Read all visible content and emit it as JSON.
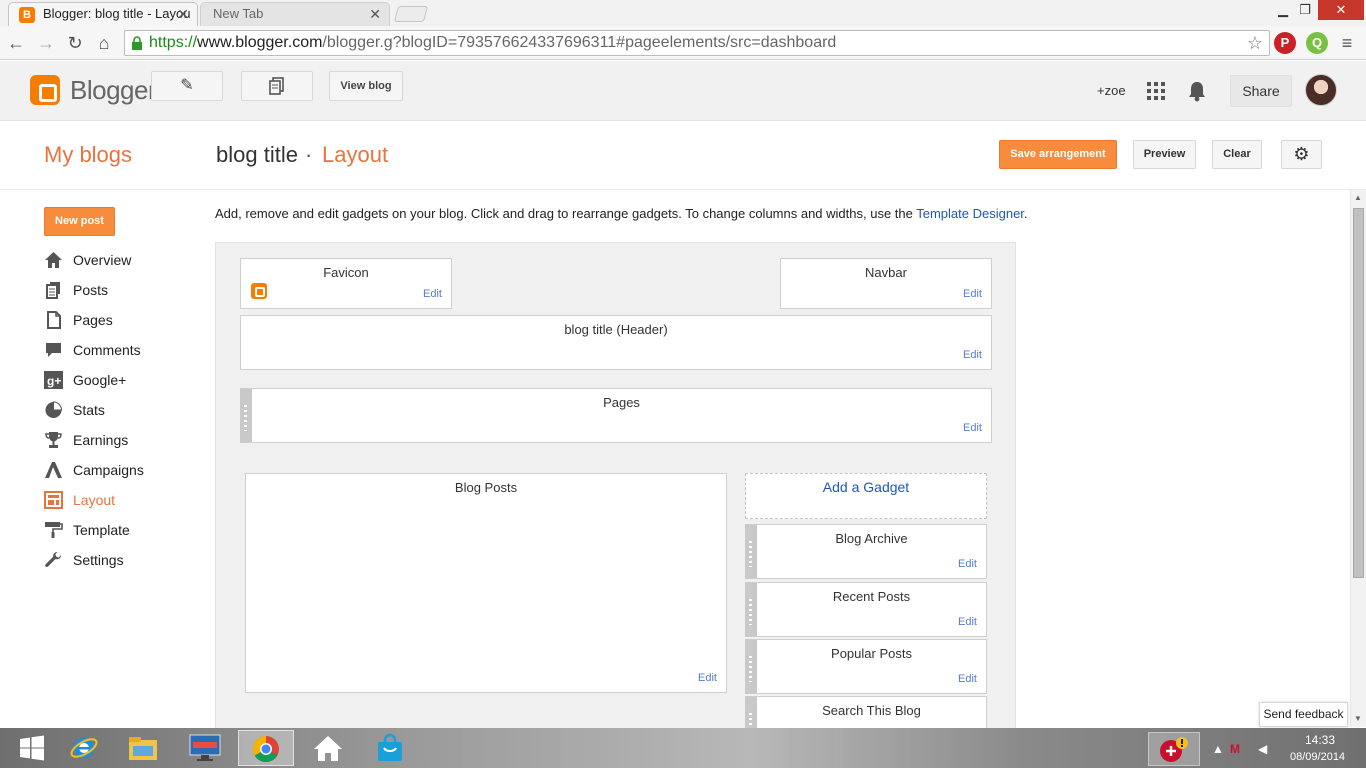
{
  "browser": {
    "active_tab_title": "Blogger: blog title - Layou",
    "inactive_tab_title": "New Tab",
    "url_scheme": "https://",
    "url_rest": "www.blogger.com/blogger.g?blogID=7935766243376963 11#pageelements/src=dashboard",
    "url_display_host": "www.blogger.com",
    "url_display_path": "/blogger.g?blogID=793576624337696311#pageelements/src=dashboard"
  },
  "blogger_header": {
    "logo_text": "Blogger",
    "view_blog_label": "View blog",
    "user_name": "+zoe",
    "share_label": "Share"
  },
  "titlebar": {
    "my_blogs": "My blogs",
    "blog_title": "blog title",
    "separator": "·",
    "section": "Layout",
    "save_label": "Save arrangement",
    "preview_label": "Preview",
    "clear_label": "Clear"
  },
  "sidebar": {
    "new_post_label": "New post",
    "items": [
      {
        "label": "Overview",
        "icon": "home-icon"
      },
      {
        "label": "Posts",
        "icon": "posts-icon"
      },
      {
        "label": "Pages",
        "icon": "pages-icon"
      },
      {
        "label": "Comments",
        "icon": "comments-icon"
      },
      {
        "label": "Google+",
        "icon": "google-plus-icon"
      },
      {
        "label": "Stats",
        "icon": "stats-icon"
      },
      {
        "label": "Earnings",
        "icon": "trophy-icon"
      },
      {
        "label": "Campaigns",
        "icon": "campaigns-icon"
      },
      {
        "label": "Layout",
        "icon": "layout-icon",
        "active": true
      },
      {
        "label": "Template",
        "icon": "paint-roller-icon"
      },
      {
        "label": "Settings",
        "icon": "wrench-icon"
      }
    ]
  },
  "main": {
    "intro_text": "Add, remove and edit gadgets on your blog. Click and drag to rearrange gadgets. To change columns and widths, use the ",
    "intro_link": "Template Designer",
    "intro_end": ".",
    "add_gadget_label": "Add a Gadget",
    "edit_label": "Edit",
    "gadgets": {
      "favicon": "Favicon",
      "navbar": "Navbar",
      "header": "blog title (Header)",
      "pages": "Pages",
      "blog_posts": "Blog Posts",
      "blog_archive": "Blog Archive",
      "recent_posts": "Recent Posts",
      "popular_posts": "Popular Posts",
      "search_blog": "Search This Blog"
    }
  },
  "feedback_label": "Send feedback",
  "taskbar": {
    "time": "14:33",
    "date": "08/09/2014"
  },
  "colors": {
    "accent_orange": "#f68c3c",
    "link_blue": "#2255bb",
    "active_nav": "#e8733c"
  }
}
